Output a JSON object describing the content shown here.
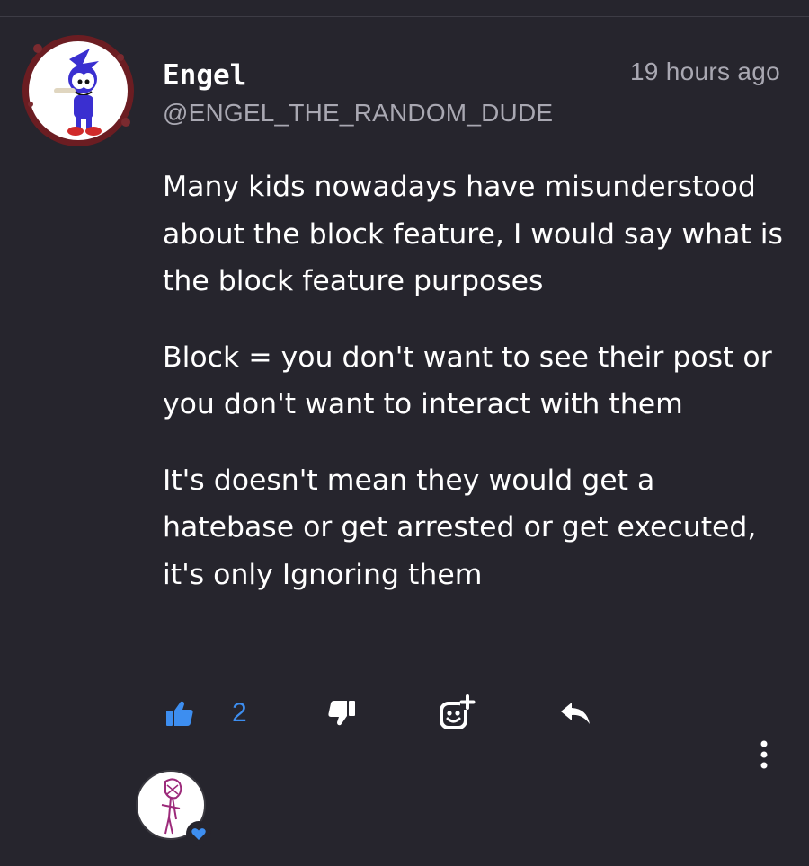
{
  "post": {
    "author": {
      "display_name": "Engel",
      "handle": "@ENGEL_THE_RANDOM_DUDE"
    },
    "timestamp": "19 hours ago",
    "paragraphs": [
      "Many kids nowadays have misunderstood about the block feature, I would say what is the block feature purposes",
      "Block = you don't want to see their post or you don't want to interact with them",
      "It's doesn't mean they would get a hatebase or get arrested or get executed, it's only Ignoring them"
    ]
  },
  "actions": {
    "like_count": "2",
    "like_icon": "thumbs-up-icon",
    "dislike_icon": "thumbs-down-icon",
    "react_icon": "add-reaction-icon",
    "reply_icon": "reply-arrow-icon",
    "more_icon": "more-vertical-icon"
  },
  "colors": {
    "background": "#26252d",
    "accent": "#3d8ef0",
    "text": "#ffffff",
    "muted_text": "#a9a8b2"
  }
}
